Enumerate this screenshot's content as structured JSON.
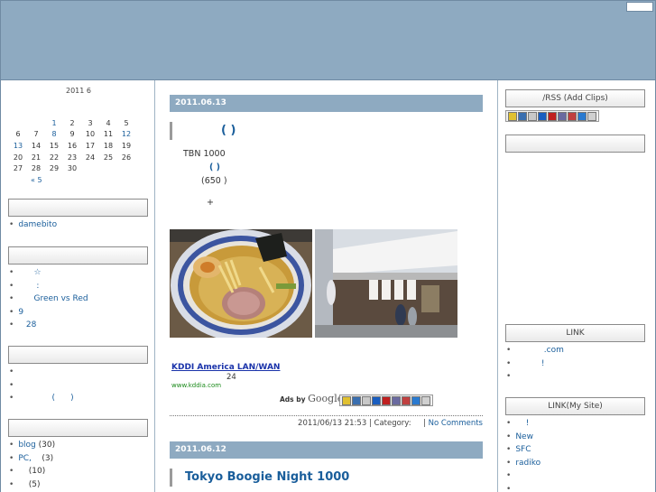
{
  "calendar": {
    "title": "2011 6",
    "weeks": [
      [
        {
          "d": "",
          "l": false
        },
        {
          "d": "",
          "l": false
        },
        {
          "d": "1",
          "l": true
        },
        {
          "d": "2",
          "l": false
        },
        {
          "d": "3",
          "l": false
        },
        {
          "d": "4",
          "l": false
        },
        {
          "d": "5",
          "l": false
        }
      ],
      [
        {
          "d": "6",
          "l": false
        },
        {
          "d": "7",
          "l": false
        },
        {
          "d": "8",
          "l": true
        },
        {
          "d": "9",
          "l": false
        },
        {
          "d": "10",
          "l": false
        },
        {
          "d": "11",
          "l": false
        },
        {
          "d": "12",
          "l": true
        }
      ],
      [
        {
          "d": "13",
          "l": true
        },
        {
          "d": "14",
          "l": false
        },
        {
          "d": "15",
          "l": false
        },
        {
          "d": "16",
          "l": false
        },
        {
          "d": "17",
          "l": false
        },
        {
          "d": "18",
          "l": false
        },
        {
          "d": "19",
          "l": false
        }
      ],
      [
        {
          "d": "20",
          "l": false
        },
        {
          "d": "21",
          "l": false
        },
        {
          "d": "22",
          "l": false
        },
        {
          "d": "23",
          "l": false
        },
        {
          "d": "24",
          "l": false
        },
        {
          "d": "25",
          "l": false
        },
        {
          "d": "26",
          "l": false
        }
      ],
      [
        {
          "d": "27",
          "l": false
        },
        {
          "d": "28",
          "l": false
        },
        {
          "d": "29",
          "l": false
        },
        {
          "d": "30",
          "l": false
        },
        {
          "d": "",
          "l": false
        },
        {
          "d": "",
          "l": false
        },
        {
          "d": "",
          "l": false
        }
      ]
    ],
    "prev": "« 5"
  },
  "left_sidebar": {
    "box1": "",
    "list1": [
      {
        "text": "damebito",
        "count": ""
      }
    ],
    "box2": "",
    "list2": [
      {
        "text": "      ☆",
        "count": ""
      },
      {
        "text": "       :",
        "count": ""
      },
      {
        "text": "      Green vs Red",
        "count": ""
      },
      {
        "text": "9",
        "count": ""
      },
      {
        "text": "   28",
        "count": ""
      }
    ],
    "box3": "",
    "list3": [
      {
        "text": "",
        "count": ""
      },
      {
        "text": "",
        "count": ""
      },
      {
        "text": "             (      )",
        "count": ""
      }
    ],
    "box4": "",
    "list4": [
      {
        "text": "blog",
        "count": " (30)"
      },
      {
        "text": "PC,",
        "count": "    (3)"
      },
      {
        "text": "",
        "count": "    (10)"
      },
      {
        "text": "",
        "count": "    (5)"
      }
    ]
  },
  "posts": [
    {
      "date": "2011.06.13",
      "title": "(      )",
      "lines": [
        "TBN 1000",
        "(      )",
        "(650 )",
        "+"
      ],
      "ad": {
        "title": "KDDI America  LAN/WAN",
        "text": "24",
        "url": "www.kddia.com",
        "ads_by": "Ads by",
        "google": "Google"
      },
      "meta": {
        "time": "2011/06/13 21:53 | Category:",
        "comments": "No Comments"
      }
    },
    {
      "date": "2011.06.12",
      "title": "Tokyo Boogie Night 1000"
    }
  ],
  "right_sidebar": {
    "rss_box": "/RSS (Add Clips)",
    "box2": "",
    "link_box": "LINK",
    "links": [
      {
        "text": "           .com"
      },
      {
        "text": "          !"
      },
      {
        "text": ""
      }
    ],
    "mysite_box": "LINK(My Site)",
    "mysite": [
      {
        "text": "    !"
      },
      {
        "text": "New"
      },
      {
        "text": "SFC"
      },
      {
        "text": "radiko"
      },
      {
        "text": ""
      },
      {
        "text": ""
      }
    ]
  },
  "colors": {
    "accent": "#8eaac1",
    "link": "#1a5e9b"
  },
  "icons": [
    "bookmark-icons"
  ]
}
